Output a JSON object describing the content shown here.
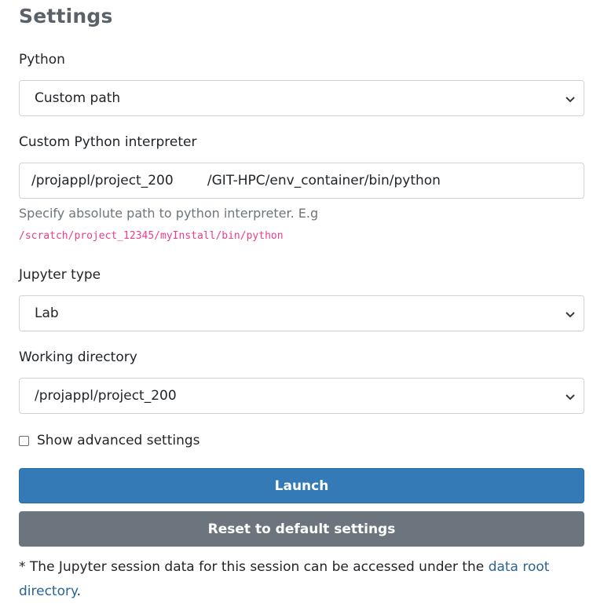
{
  "page": {
    "title": "Settings"
  },
  "python": {
    "label": "Python",
    "selected": "Custom path"
  },
  "interpreter": {
    "label": "Custom Python interpreter",
    "value": "/projappl/project_200        /GIT-HPC/env_container/bin/python",
    "help": "Specify absolute path to python interpreter. E.g",
    "example": "/scratch/project_12345/myInstall/bin/python"
  },
  "jupyter_type": {
    "label": "Jupyter type",
    "selected": "Lab"
  },
  "working_directory": {
    "label": "Working directory",
    "selected": "/projappl/project_200"
  },
  "advanced": {
    "label": "Show advanced settings",
    "checked": false
  },
  "buttons": {
    "launch": "Launch",
    "reset": "Reset to default settings"
  },
  "note": {
    "text": "* The Jupyter session data for this session can be accessed under the ",
    "link": "data root directory",
    "end": "."
  },
  "icons": {
    "select_arrow": "chevron-down-icon"
  },
  "colors": {
    "primary": "#337ab7",
    "secondary": "#6c757d",
    "code": "#e83e8c",
    "link": "#2a6496"
  }
}
